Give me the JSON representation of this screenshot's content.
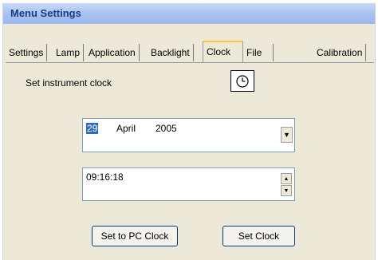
{
  "window": {
    "title": "Menu Settings"
  },
  "tabs": [
    {
      "label": "Settings"
    },
    {
      "label": "Lamp"
    },
    {
      "label": "Application"
    },
    {
      "label": "Backlight"
    },
    {
      "label": "Clock"
    },
    {
      "label": "File"
    },
    {
      "label": "Calibration"
    }
  ],
  "active_tab": "Clock",
  "clock": {
    "heading": "Set instrument clock",
    "icon": "clock-icon",
    "date": {
      "day": "29",
      "month": "April",
      "year": "2005"
    },
    "time": "09:16:18",
    "buttons": {
      "set_to_pc": "Set to PC Clock",
      "set_clock": "Set Clock"
    }
  }
}
